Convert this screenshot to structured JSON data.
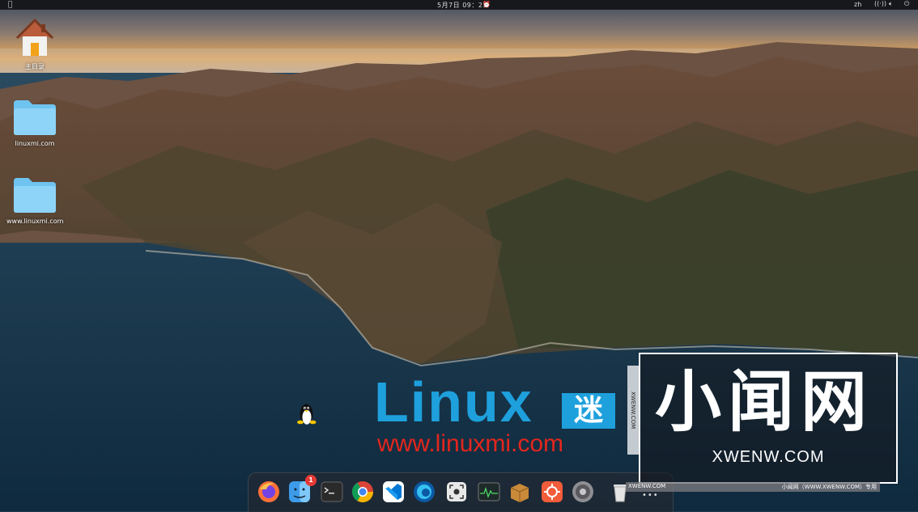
{
  "topbar": {
    "apple": "",
    "clock": "5月7日  09：25",
    "lang": "zh"
  },
  "desktop": {
    "icons": [
      {
        "label": "主目录",
        "icon": "home-icon"
      },
      {
        "label": "linuxmi.com",
        "icon": "folder-icon"
      },
      {
        "label": "www.linuxmi.com",
        "icon": "folder-icon"
      }
    ]
  },
  "dock": {
    "apps": [
      {
        "name": "Firefox",
        "icon": "firefox-icon"
      },
      {
        "name": "Finder",
        "icon": "finder-icon",
        "badge": "1"
      },
      {
        "name": "Terminal",
        "icon": "terminal-icon"
      },
      {
        "name": "Chrome",
        "icon": "chrome-icon"
      },
      {
        "name": "VS Code",
        "icon": "vscode-icon"
      },
      {
        "name": "Edge",
        "icon": "edge-icon"
      },
      {
        "name": "Screenshot",
        "icon": "screenshot-icon"
      },
      {
        "name": "System Monitor",
        "icon": "system-monitor-icon"
      },
      {
        "name": "Package Installer",
        "icon": "package-icon"
      },
      {
        "name": "App Center",
        "icon": "app-center-icon"
      },
      {
        "name": "Settings",
        "icon": "settings-icon"
      },
      {
        "name": "Trash",
        "icon": "trash-icon"
      }
    ],
    "more": "•••"
  },
  "watermark": {
    "linux_word": "Linux",
    "linux_mi": "迷",
    "linux_url": "www.linuxmi.com",
    "xwenw_big": "小闻网",
    "xwenw_sub": "XWENW.COM",
    "xwenw_vertical": "XWENW.COM",
    "strip_left": "XWENW.COM",
    "strip_right": "小闻网（WWW.XWENW.COM）专用"
  },
  "colors": {
    "sky_top": "#3a4a5e",
    "sunset": "#e8a85a",
    "sea": "#143248",
    "linux_blue": "#1ea0dc",
    "linux_red": "#e3261d"
  }
}
